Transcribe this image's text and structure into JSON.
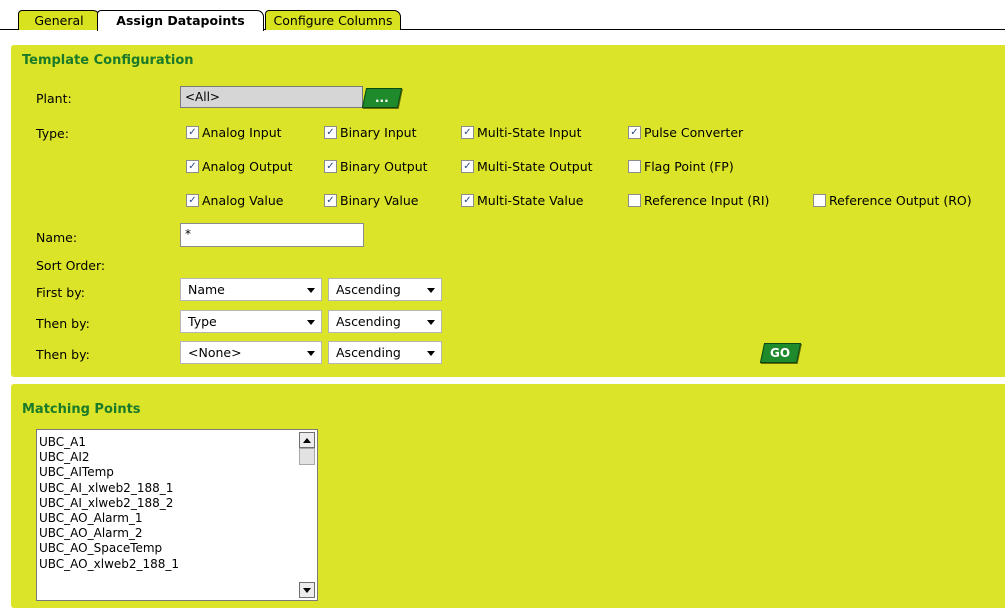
{
  "tabs": [
    {
      "label": "General"
    },
    {
      "label": "Assign Datapoints",
      "active": true
    },
    {
      "label": "Configure Columns"
    }
  ],
  "template": {
    "title": "Template Configuration",
    "plant_label": "Plant:",
    "plant_value": "<All>",
    "browse_label": "...",
    "type_label": "Type:",
    "types": [
      {
        "label": "Analog Input",
        "checked": true
      },
      {
        "label": "Binary Input",
        "checked": true
      },
      {
        "label": "Multi-State Input",
        "checked": true
      },
      {
        "label": "Pulse Converter",
        "checked": true
      },
      {
        "label": "Analog Output",
        "checked": true
      },
      {
        "label": "Binary Output",
        "checked": true
      },
      {
        "label": "Multi-State Output",
        "checked": true
      },
      {
        "label": "Flag Point (FP)",
        "checked": false
      },
      {
        "label": "Analog Value",
        "checked": true
      },
      {
        "label": "Binary Value",
        "checked": true
      },
      {
        "label": "Multi-State Value",
        "checked": true
      },
      {
        "label": "Reference Input (RI)",
        "checked": false
      },
      {
        "label": "Reference Output (RO)",
        "checked": false
      }
    ],
    "name_label": "Name:",
    "name_value": "*",
    "sort_order_label": "Sort Order:",
    "sorts": [
      {
        "label": "First by:",
        "field": "Name",
        "direction": "Ascending"
      },
      {
        "label": "Then by:",
        "field": "Type",
        "direction": "Ascending"
      },
      {
        "label": "Then by:",
        "field": "<None>",
        "direction": "Ascending"
      }
    ],
    "go_label": "GO"
  },
  "matching": {
    "title": "Matching Points",
    "items": [
      "UBC_A1",
      "UBC_AI2",
      "UBC_AITemp",
      "UBC_AI_xlweb2_188_1",
      "UBC_AI_xlweb2_188_2",
      "UBC_AO_Alarm_1",
      "UBC_AO_Alarm_2",
      "UBC_AO_SpaceTemp",
      "UBC_AO_xlweb2_188_1"
    ]
  },
  "colors": {
    "panel": "#dbe428",
    "title_green": "#1a7a2a",
    "button_green": "#1f8a2b"
  }
}
